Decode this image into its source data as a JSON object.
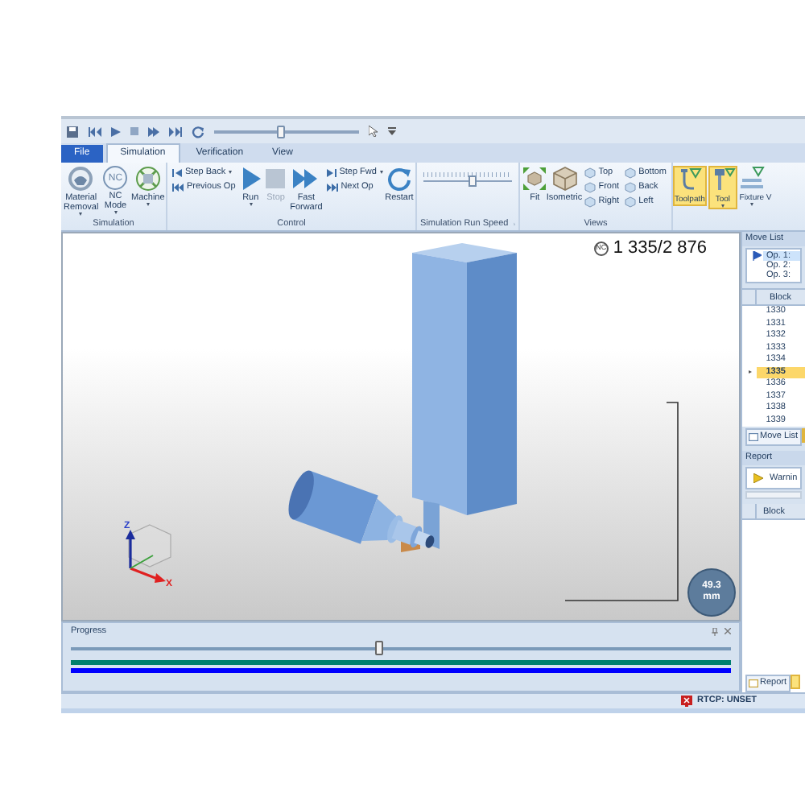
{
  "quick_access": {
    "level": 0.45
  },
  "tabs": [
    {
      "label": "File",
      "kind": "file",
      "selected": false
    },
    {
      "label": "Simulation",
      "kind": "tab",
      "selected": true
    },
    {
      "label": "Verification",
      "kind": "tab",
      "selected": false
    },
    {
      "label": "View",
      "kind": "tab",
      "selected": false
    }
  ],
  "ribbon_groups": [
    {
      "title": "Simulation",
      "items": [
        {
          "kind": "large",
          "label": "Material Removal",
          "dropdown": true
        },
        {
          "kind": "large",
          "label": "NC Mode",
          "badge": "NC",
          "dropdown": true
        },
        {
          "kind": "large",
          "label": "Machine",
          "dropdown": true
        }
      ]
    },
    {
      "title": "Control",
      "items": [
        {
          "kind": "stack",
          "entries": [
            {
              "label": "Step Back",
              "dropdown": true
            },
            {
              "label": "Previous Op"
            }
          ]
        },
        {
          "kind": "large",
          "label": "Run",
          "dropdown": true,
          "disabled": false
        },
        {
          "kind": "large",
          "label": "Stop",
          "disabled": true
        },
        {
          "kind": "large",
          "label": "Fast Forward",
          "disabled": false
        },
        {
          "kind": "stack",
          "entries": [
            {
              "label": "Step Fwd",
              "dropdown": true
            },
            {
              "label": "Next Op"
            }
          ]
        },
        {
          "kind": "large",
          "label": "Restart",
          "disabled": false
        }
      ]
    },
    {
      "title": "Simulation Run Speed",
      "launcher": true,
      "items": [
        {
          "kind": "slider",
          "level": 0.55
        }
      ]
    },
    {
      "title": "Views",
      "items": [
        {
          "kind": "large",
          "label": "Fit"
        },
        {
          "kind": "large",
          "label": "Isometric"
        },
        {
          "kind": "stack",
          "entries": [
            {
              "label": "Top"
            },
            {
              "label": "Front"
            },
            {
              "label": "Right"
            }
          ]
        },
        {
          "kind": "stack",
          "entries": [
            {
              "label": "Bottom"
            },
            {
              "label": "Back"
            },
            {
              "label": "Left"
            }
          ]
        }
      ]
    },
    {
      "items": [
        {
          "kind": "large",
          "label": "Toolpath",
          "selected": true
        },
        {
          "kind": "large",
          "label": "Tool",
          "selected": true,
          "dropdown": true
        },
        {
          "kind": "large",
          "label": "Fixture",
          "selected": false,
          "dropdown": true
        },
        {
          "kind": "large",
          "label": "V",
          "selected": false
        }
      ]
    }
  ],
  "viewport": {
    "counter_badge": "NC",
    "counter": "1 335/2 876",
    "axis_labels": [
      "Z",
      "X"
    ],
    "measurement": "49.3 mm"
  },
  "move_list": {
    "title": "Move List",
    "operations": [
      {
        "label": "Op. 1:",
        "selected": true
      },
      {
        "label": "Op. 2:",
        "selected": false
      },
      {
        "label": "Op. 3:",
        "selected": false
      }
    ],
    "block_header": "Block",
    "blocks": [
      {
        "value": "1330",
        "selected": false
      },
      {
        "value": "1331",
        "selected": false
      },
      {
        "value": "1332",
        "selected": false
      },
      {
        "value": "1333",
        "selected": false
      },
      {
        "value": "1334",
        "selected": false
      },
      {
        "value": "1335",
        "selected": true
      },
      {
        "value": "1336",
        "selected": false
      },
      {
        "value": "1337",
        "selected": false
      },
      {
        "value": "1338",
        "selected": false
      },
      {
        "value": "1339",
        "selected": false
      }
    ],
    "tab": "Move List"
  },
  "report": {
    "title": "Report",
    "entries": [
      "Warnin"
    ],
    "block_header": "Block",
    "tab": "Report"
  },
  "progress": {
    "title": "Progress",
    "level": 0.465,
    "bars": [
      {
        "color": "#00806e",
        "level": 1
      },
      {
        "color": "#0000ff",
        "level": 1
      }
    ]
  },
  "status_bar": {
    "rtcp": "RTCP: UNSET"
  }
}
